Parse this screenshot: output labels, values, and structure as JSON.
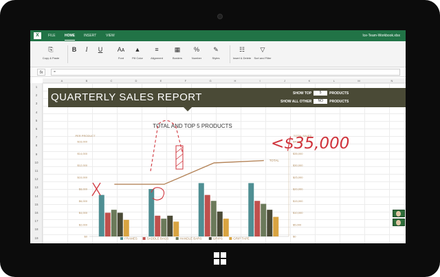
{
  "app": {
    "file_name": "Ice-Team-Workbook.xlsx",
    "tabs": [
      "FILE",
      "HOME",
      "INSERT",
      "VIEW"
    ],
    "active_tab": "HOME"
  },
  "ribbon": {
    "copy_paste": "Copy & Paste",
    "bold": "B",
    "italic": "I",
    "underline": "U",
    "font": "Font",
    "fill_color": "Fill Color",
    "alignment": "Alignment",
    "borders": "Borders",
    "number": "Number",
    "styles": "Styles",
    "insert_delete": "Insert & Delete",
    "sort_filter": "Sort and Filter"
  },
  "formula_bar": {
    "fx": "fx",
    "value": "="
  },
  "columns": [
    "A",
    "B",
    "C",
    "D",
    "E",
    "F",
    "G",
    "H",
    "I",
    "J",
    "K",
    "L",
    "M",
    "N"
  ],
  "rows": [
    "1",
    "2",
    "3",
    "4",
    "5",
    "6",
    "7",
    "8",
    "9",
    "10",
    "11",
    "12",
    "13",
    "14",
    "15",
    "16",
    "17",
    "18",
    "19"
  ],
  "report": {
    "title": "QUARTERLY SALES REPORT",
    "show_top_label": "SHOW TOP",
    "show_top_value": "5",
    "products_label": "PRODUCTS",
    "show_all_other_label": "SHOW ALL OTHER",
    "show_all_other_value": "NO",
    "products_label_2": "PRODUCTS"
  },
  "annotation": {
    "handwritten": "<$35,000",
    "color": "#d0343c"
  },
  "colors": {
    "excel_green": "#217346",
    "banner": "#4a4a36",
    "accent_ink": "#d0343c"
  },
  "chart_data": {
    "type": "bar",
    "title": "TOTAL AND TOP 5 PRODUCTS",
    "ylabel": "PER PRODUCT",
    "y2label": "TOTAL SALES",
    "categories": [
      "QUARTER 1",
      "QUARTER 2",
      "QUARTER 3",
      "QUARTER 4"
    ],
    "ylim": [
      0,
      16000
    ],
    "y_ticks": [
      "$16,000",
      "$14,000",
      "$12,000",
      "$10,000",
      "$8,000",
      "$6,000",
      "$4,000",
      "$2,000",
      "$0"
    ],
    "y2lim": [
      0,
      40000
    ],
    "y2_ticks": [
      "$40,000",
      "$35,000",
      "$30,000",
      "$25,000",
      "$20,000",
      "$15,000",
      "$10,000",
      "$5,000",
      "$0"
    ],
    "series": [
      {
        "name": "FRAMES",
        "color": "#4f8f93",
        "values": [
          7000,
          8000,
          9000,
          9000
        ]
      },
      {
        "name": "SADDLE BAGS",
        "color": "#c0504d",
        "values": [
          4000,
          3500,
          7000,
          6000
        ]
      },
      {
        "name": "HANDLE BARS",
        "color": "#6b7a5a",
        "values": [
          4500,
          3000,
          6000,
          5500
        ]
      },
      {
        "name": "GRIPS",
        "color": "#4a4a36",
        "values": [
          4000,
          3500,
          4200,
          4500
        ]
      },
      {
        "name": "GRIP TAPE",
        "color": "#d9a441",
        "values": [
          2800,
          2500,
          3000,
          3300
        ]
      }
    ],
    "total": {
      "name": "TOTAL",
      "color": "#b5855a",
      "values": [
        22000,
        22000,
        31000,
        32000
      ]
    }
  }
}
